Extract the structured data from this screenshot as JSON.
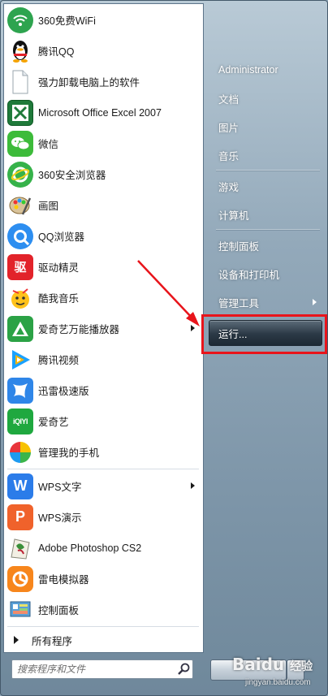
{
  "colors": {
    "accent_red": "#e8141b",
    "menu_bg": "#ffffff",
    "right_pane": "#8fa7b9"
  },
  "left_items": [
    {
      "label": "360免费WiFi",
      "icon": "wifi-icon"
    },
    {
      "label": "腾讯QQ",
      "icon": "qq-penguin-icon"
    },
    {
      "label": "强力卸载电脑上的软件",
      "icon": "document-icon"
    },
    {
      "label": "Microsoft Office Excel 2007",
      "icon": "excel-icon"
    },
    {
      "label": "微信",
      "icon": "wechat-icon"
    },
    {
      "label": "360安全浏览器",
      "icon": "360-browser-icon"
    },
    {
      "label": "画图",
      "icon": "paint-icon"
    },
    {
      "label": "QQ浏览器",
      "icon": "qq-browser-icon"
    },
    {
      "label": "驱动精灵",
      "icon": "driver-genius-icon",
      "glyph": "驱"
    },
    {
      "label": "酷我音乐",
      "icon": "kuwo-music-icon"
    },
    {
      "label": "爱奇艺万能播放器",
      "icon": "iqiyi-player-icon"
    },
    {
      "label": "腾讯视频",
      "icon": "tencent-video-icon"
    },
    {
      "label": "迅雷极速版",
      "icon": "xunlei-icon"
    },
    {
      "label": "爱奇艺",
      "icon": "iqiyi-icon",
      "glyph": "iQIYI"
    },
    {
      "label": "管理我的手机",
      "icon": "phone-manager-icon"
    },
    {
      "label": "WPS文字",
      "icon": "wps-writer-icon",
      "glyph": "W"
    },
    {
      "label": "WPS演示",
      "icon": "wps-presentation-icon",
      "glyph": "P"
    },
    {
      "label": "Adobe Photoshop CS2",
      "icon": "photoshop-icon"
    },
    {
      "label": "雷电模拟器",
      "icon": "leidian-emulator-icon"
    },
    {
      "label": "控制面板",
      "icon": "control-panel-icon"
    }
  ],
  "all_programs": "所有程序",
  "search": {
    "placeholder": "搜索程序和文件"
  },
  "right_items": [
    {
      "label": "Administrator"
    },
    {
      "label": "文档"
    },
    {
      "label": "图片"
    },
    {
      "label": "音乐"
    },
    {
      "label": "游戏"
    },
    {
      "label": "计算机"
    },
    {
      "label": "控制面板"
    },
    {
      "label": "设备和打印机"
    },
    {
      "label": "管理工具"
    },
    {
      "label": "运行..."
    }
  ],
  "watermark": {
    "brand": "Bai",
    "brand2": "du",
    "sub": "经验",
    "url": "jingyan.baidu.com"
  }
}
